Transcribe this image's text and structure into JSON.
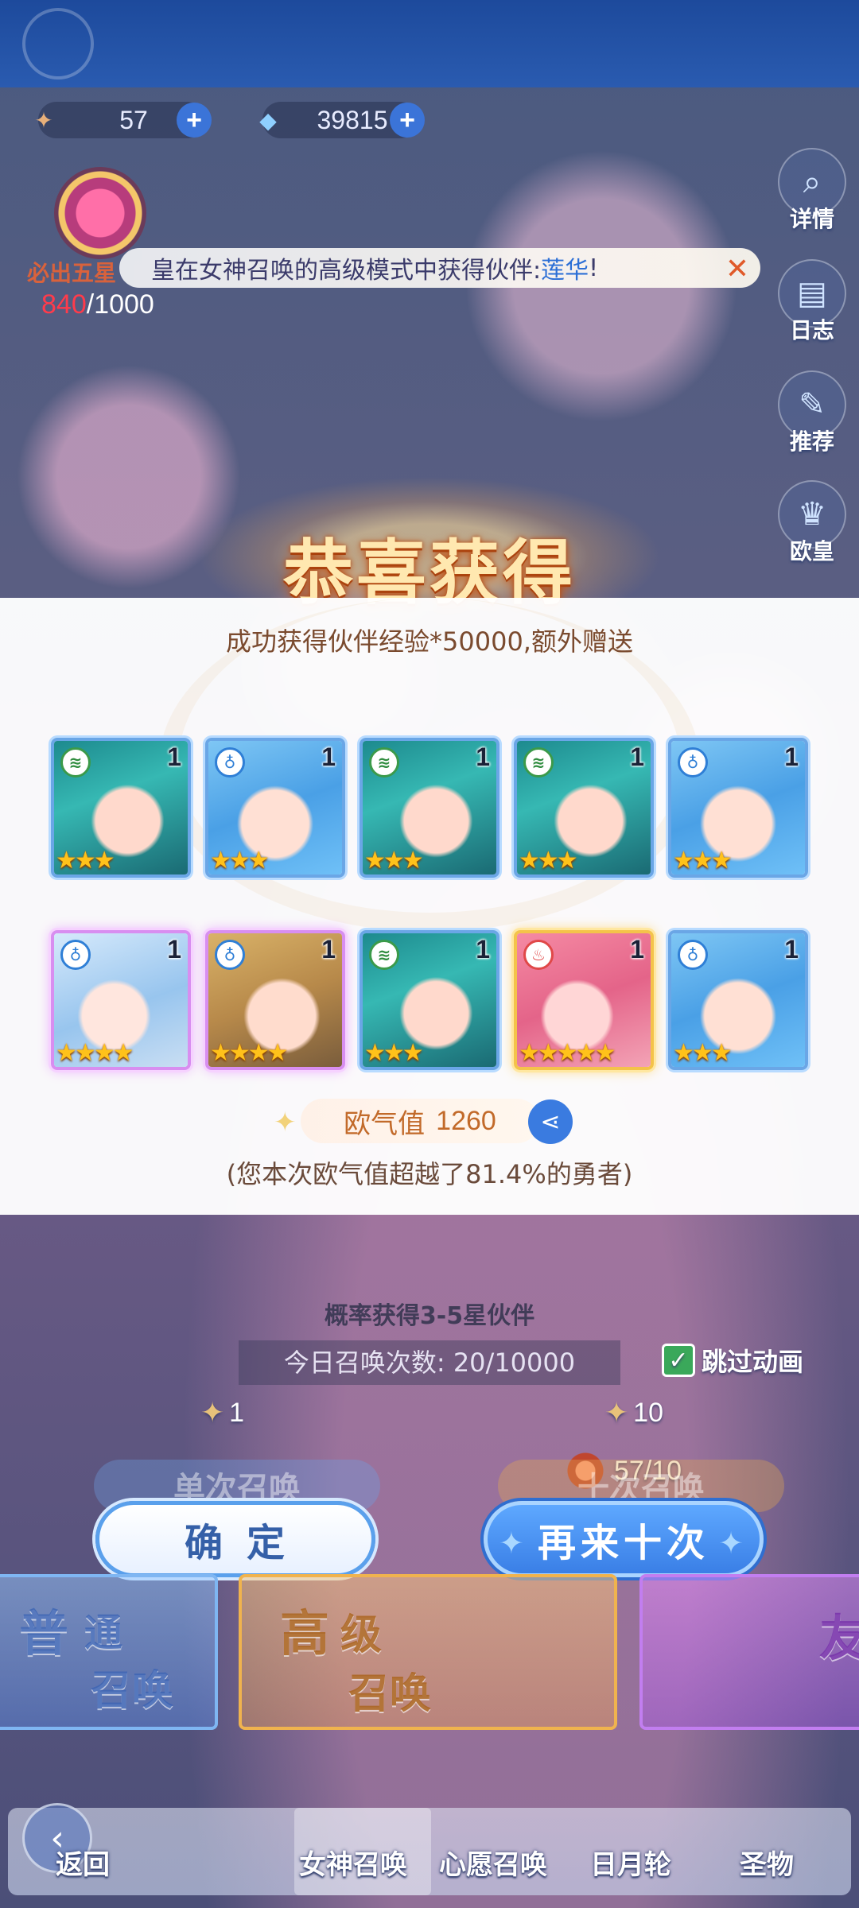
{
  "resources": [
    {
      "icon": "summon-key-icon",
      "value": "57"
    },
    {
      "icon": "crystal-icon",
      "value": "39815"
    }
  ],
  "pity": {
    "label": "必出五星",
    "current": "840",
    "total": "/1000"
  },
  "marquee": {
    "prefix": "皇在女神召唤的高级模式中获得伙伴:",
    "name": "莲华",
    "suffix": "!"
  },
  "side_buttons": [
    {
      "label": "详情",
      "icon": "search-icon"
    },
    {
      "label": "日志",
      "icon": "book-icon"
    },
    {
      "label": "推荐",
      "icon": "feather-icon"
    },
    {
      "label": "欧皇",
      "icon": "crown-icon"
    }
  ],
  "result": {
    "title": "恭喜获得",
    "subtitle": "成功获得伙伴经验*50000,额外赠送",
    "cards": [
      {
        "element": "wind",
        "level": "1",
        "stars": 3,
        "art": "teal",
        "rarity": "blue"
      },
      {
        "element": "water",
        "level": "1",
        "stars": 3,
        "art": "blue",
        "rarity": "blue"
      },
      {
        "element": "wind",
        "level": "1",
        "stars": 3,
        "art": "teal",
        "rarity": "blue"
      },
      {
        "element": "wind",
        "level": "1",
        "stars": 3,
        "art": "teal",
        "rarity": "blue"
      },
      {
        "element": "water",
        "level": "1",
        "stars": 3,
        "art": "blue",
        "rarity": "blue"
      },
      {
        "element": "water",
        "level": "1",
        "stars": 4,
        "art": "silver",
        "rarity": "purple"
      },
      {
        "element": "water",
        "level": "1",
        "stars": 4,
        "art": "blonde",
        "rarity": "purple"
      },
      {
        "element": "wind",
        "level": "1",
        "stars": 3,
        "art": "teal",
        "rarity": "blue"
      },
      {
        "element": "fire",
        "level": "1",
        "stars": 5,
        "art": "pink",
        "rarity": "gold"
      },
      {
        "element": "water",
        "level": "1",
        "stars": 3,
        "art": "blue",
        "rarity": "blue"
      }
    ],
    "luck_label": "欧气值",
    "luck_value": "1260",
    "luck_note": "(您本次欧气值超越了81.4%的勇者)"
  },
  "summon": {
    "rate_info": "概率获得3-5星伙伴",
    "daily": "今日召唤次数: 20/10000",
    "skip_label": "跳过动画",
    "skip_checked": true,
    "single_cost": "1",
    "ten_cost": "10",
    "keys_owned": "57/10",
    "single_label": "单次召唤",
    "ten_label": "十次召唤"
  },
  "buttons": {
    "confirm": "确定",
    "again": "再来十次"
  },
  "modes": [
    {
      "line1": "普",
      "line1b": "通",
      "line2": "召唤"
    },
    {
      "line1": "高",
      "line1b": "级",
      "line2": "召唤"
    },
    {
      "line1": "友"
    }
  ],
  "nav": {
    "back": "返回",
    "items": [
      "女神召唤",
      "心愿召唤",
      "日月轮",
      "圣物"
    ],
    "active": "女神召唤"
  },
  "colors": {
    "accent_blue": "#3a7fe6",
    "gold": "#ffc21a",
    "pity_red": "#ff3b4b"
  }
}
